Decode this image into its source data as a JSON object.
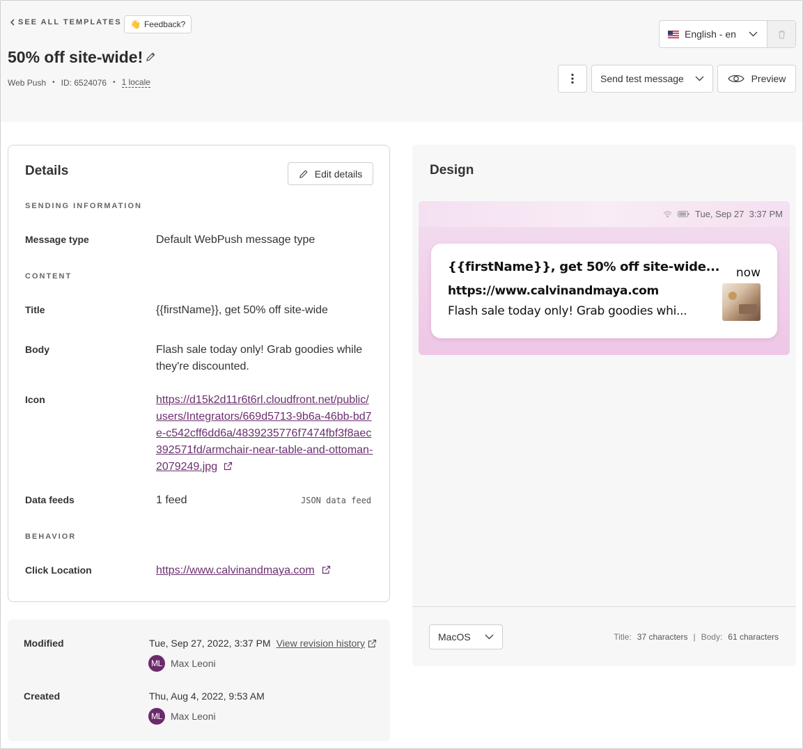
{
  "header": {
    "back_label": "SEE ALL TEMPLATES",
    "feedback_emoji": "👋",
    "feedback_label": "Feedback?",
    "title": "50% off site-wide!",
    "meta": {
      "channel": "Web Push",
      "id": "ID: 6524076",
      "locales": "1 locale"
    },
    "language": "English - en",
    "send_test_label": "Send test message",
    "preview_label": "Preview"
  },
  "details": {
    "title": "Details",
    "edit_label": "Edit details",
    "sections": {
      "sending": "SENDING INFORMATION",
      "content": "CONTENT",
      "behavior": "BEHAVIOR"
    },
    "message_type": {
      "label": "Message type",
      "value": "Default WebPush message type"
    },
    "title_row": {
      "label": "Title",
      "value": "{{firstName}}, get 50% off site-wide"
    },
    "body": {
      "label": "Body",
      "value": "Flash sale today only! Grab goodies while they're discounted."
    },
    "icon": {
      "label": "Icon",
      "value": "https://d15k2d11r6t6rl.cloudfront.net/public/users/Integrators/669d5713-9b6a-46bb-bd7e-c542cff6dd6a/4839235776f7474fbf3f8aec392571fd/armchair-near-table-and-ottoman-2079249.jpg"
    },
    "data_feeds": {
      "label": "Data feeds",
      "value": "1 feed",
      "note": "JSON data feed"
    },
    "click_location": {
      "label": "Click Location",
      "value": "https://www.calvinandmaya.com"
    }
  },
  "history": {
    "modified": {
      "label": "Modified",
      "date": "Tue, Sep 27, 2022, 3:37 PM",
      "link": "View revision history",
      "user_initials": "ML",
      "user_name": "Max Leoni"
    },
    "created": {
      "label": "Created",
      "date": "Thu, Aug 4, 2022, 9:53 AM",
      "user_initials": "ML",
      "user_name": "Max Leoni"
    }
  },
  "design": {
    "title": "Design",
    "status_time": "Tue, Sep 27  3:37 PM",
    "notification": {
      "title": "{{firstName}}, get 50% off site-wide...",
      "url": "https://www.calvinandmaya.com",
      "body": "Flash sale today only! Grab goodies whi...",
      "time": "now"
    },
    "os": "MacOS",
    "counts": {
      "title_label": "Title:",
      "title_value": "37 characters",
      "separator": "|",
      "body_label": "Body:",
      "body_value": "61 characters"
    }
  },
  "colors": {
    "accent": "#6b2f6f",
    "avatar": "#6b2a6a"
  }
}
